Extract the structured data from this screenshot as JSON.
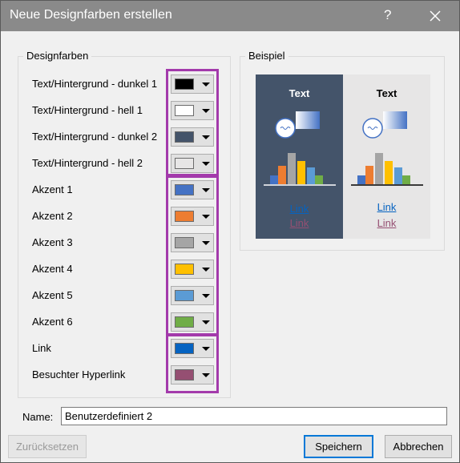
{
  "window": {
    "title": "Neue Designfarben erstellen",
    "help": "?",
    "close_icon": "close-icon"
  },
  "groups": {
    "designfarben": "Designfarben",
    "beispiel": "Beispiel"
  },
  "rows": [
    {
      "label": "Text/Hintergrund - dunkel 1",
      "color": "#000000"
    },
    {
      "label": "Text/Hintergrund - hell 1",
      "color": "#ffffff"
    },
    {
      "label": "Text/Hintergrund - dunkel 2",
      "color": "#44546a"
    },
    {
      "label": "Text/Hintergrund - hell 2",
      "color": "#e7e6e6"
    },
    {
      "label": "Akzent 1",
      "color": "#4472c4"
    },
    {
      "label": "Akzent 2",
      "color": "#ed7d31"
    },
    {
      "label": "Akzent 3",
      "color": "#a5a5a5"
    },
    {
      "label": "Akzent 4",
      "color": "#ffc000"
    },
    {
      "label": "Akzent 5",
      "color": "#5b9bd5"
    },
    {
      "label": "Akzent 6",
      "color": "#70ad47"
    },
    {
      "label": "Link",
      "color": "#0563c1"
    },
    {
      "label": "Besuchter Hyperlink",
      "color": "#954f72"
    }
  ],
  "preview": {
    "dark": {
      "text": "Text",
      "link": "Link",
      "visited": "Link",
      "bg": "#44546a",
      "fg": "#ffffff"
    },
    "light": {
      "text": "Text",
      "link": "Link",
      "visited": "Link",
      "bg": "#e7e6e6",
      "fg": "#000000"
    }
  },
  "name": {
    "label": "Name:",
    "value": "Benutzerdefiniert 2"
  },
  "buttons": {
    "reset": "Zurücksetzen",
    "save": "Speichern",
    "cancel": "Abbrechen"
  }
}
